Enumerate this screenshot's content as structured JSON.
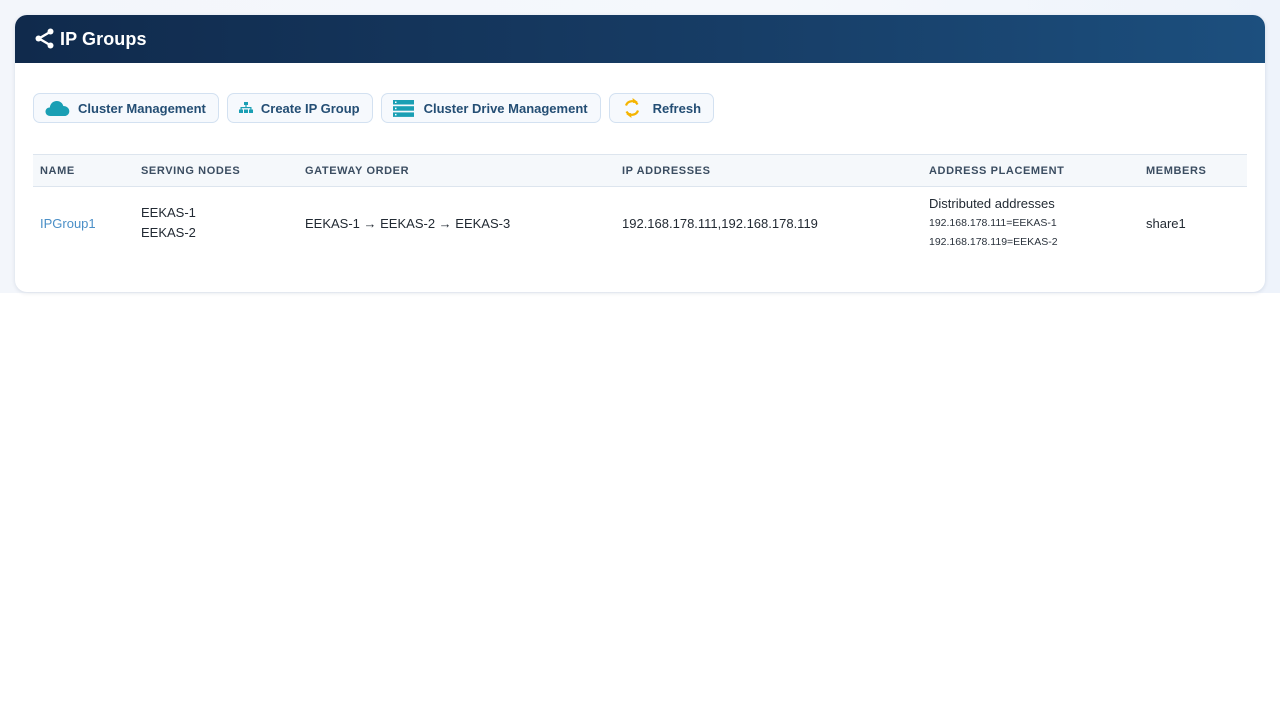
{
  "header": {
    "title": "IP Groups",
    "icon": "share-icon"
  },
  "toolbar": {
    "buttons": [
      {
        "label": "Cluster Management",
        "icon": "cloud-icon",
        "color": "#1a9fb4"
      },
      {
        "label": "Create IP Group",
        "icon": "sitemap-icon",
        "color": "#1a9fb4"
      },
      {
        "label": "Cluster Drive Management",
        "icon": "server-icon",
        "color": "#1a9fb4"
      },
      {
        "label": "Refresh",
        "icon": "refresh-icon",
        "color": "#f5b400"
      }
    ]
  },
  "table": {
    "columns": [
      "NAME",
      "SERVING NODES",
      "GATEWAY ORDER",
      "IP ADDRESSES",
      "ADDRESS PLACEMENT",
      "MEMBERS"
    ],
    "rows": [
      {
        "name": "IPGroup1",
        "serving_nodes": [
          "EEKAS-1",
          "EEKAS-2"
        ],
        "gateway_order": "EEKAS-1 → EEKAS-2 → EEKAS-3",
        "ip_addresses": "192.168.178.111,192.168.178.119",
        "address_placement": {
          "title": "Distributed addresses",
          "entries": [
            "192.168.178.111=EEKAS-1",
            "192.168.178.119=EEKAS-2"
          ]
        },
        "members": "share1"
      }
    ]
  },
  "colors": {
    "header_start": "#102a4c",
    "header_end": "#1c4f7e",
    "link": "#4a8fc7",
    "accent": "#1a9fb4",
    "refresh": "#f5b400"
  }
}
